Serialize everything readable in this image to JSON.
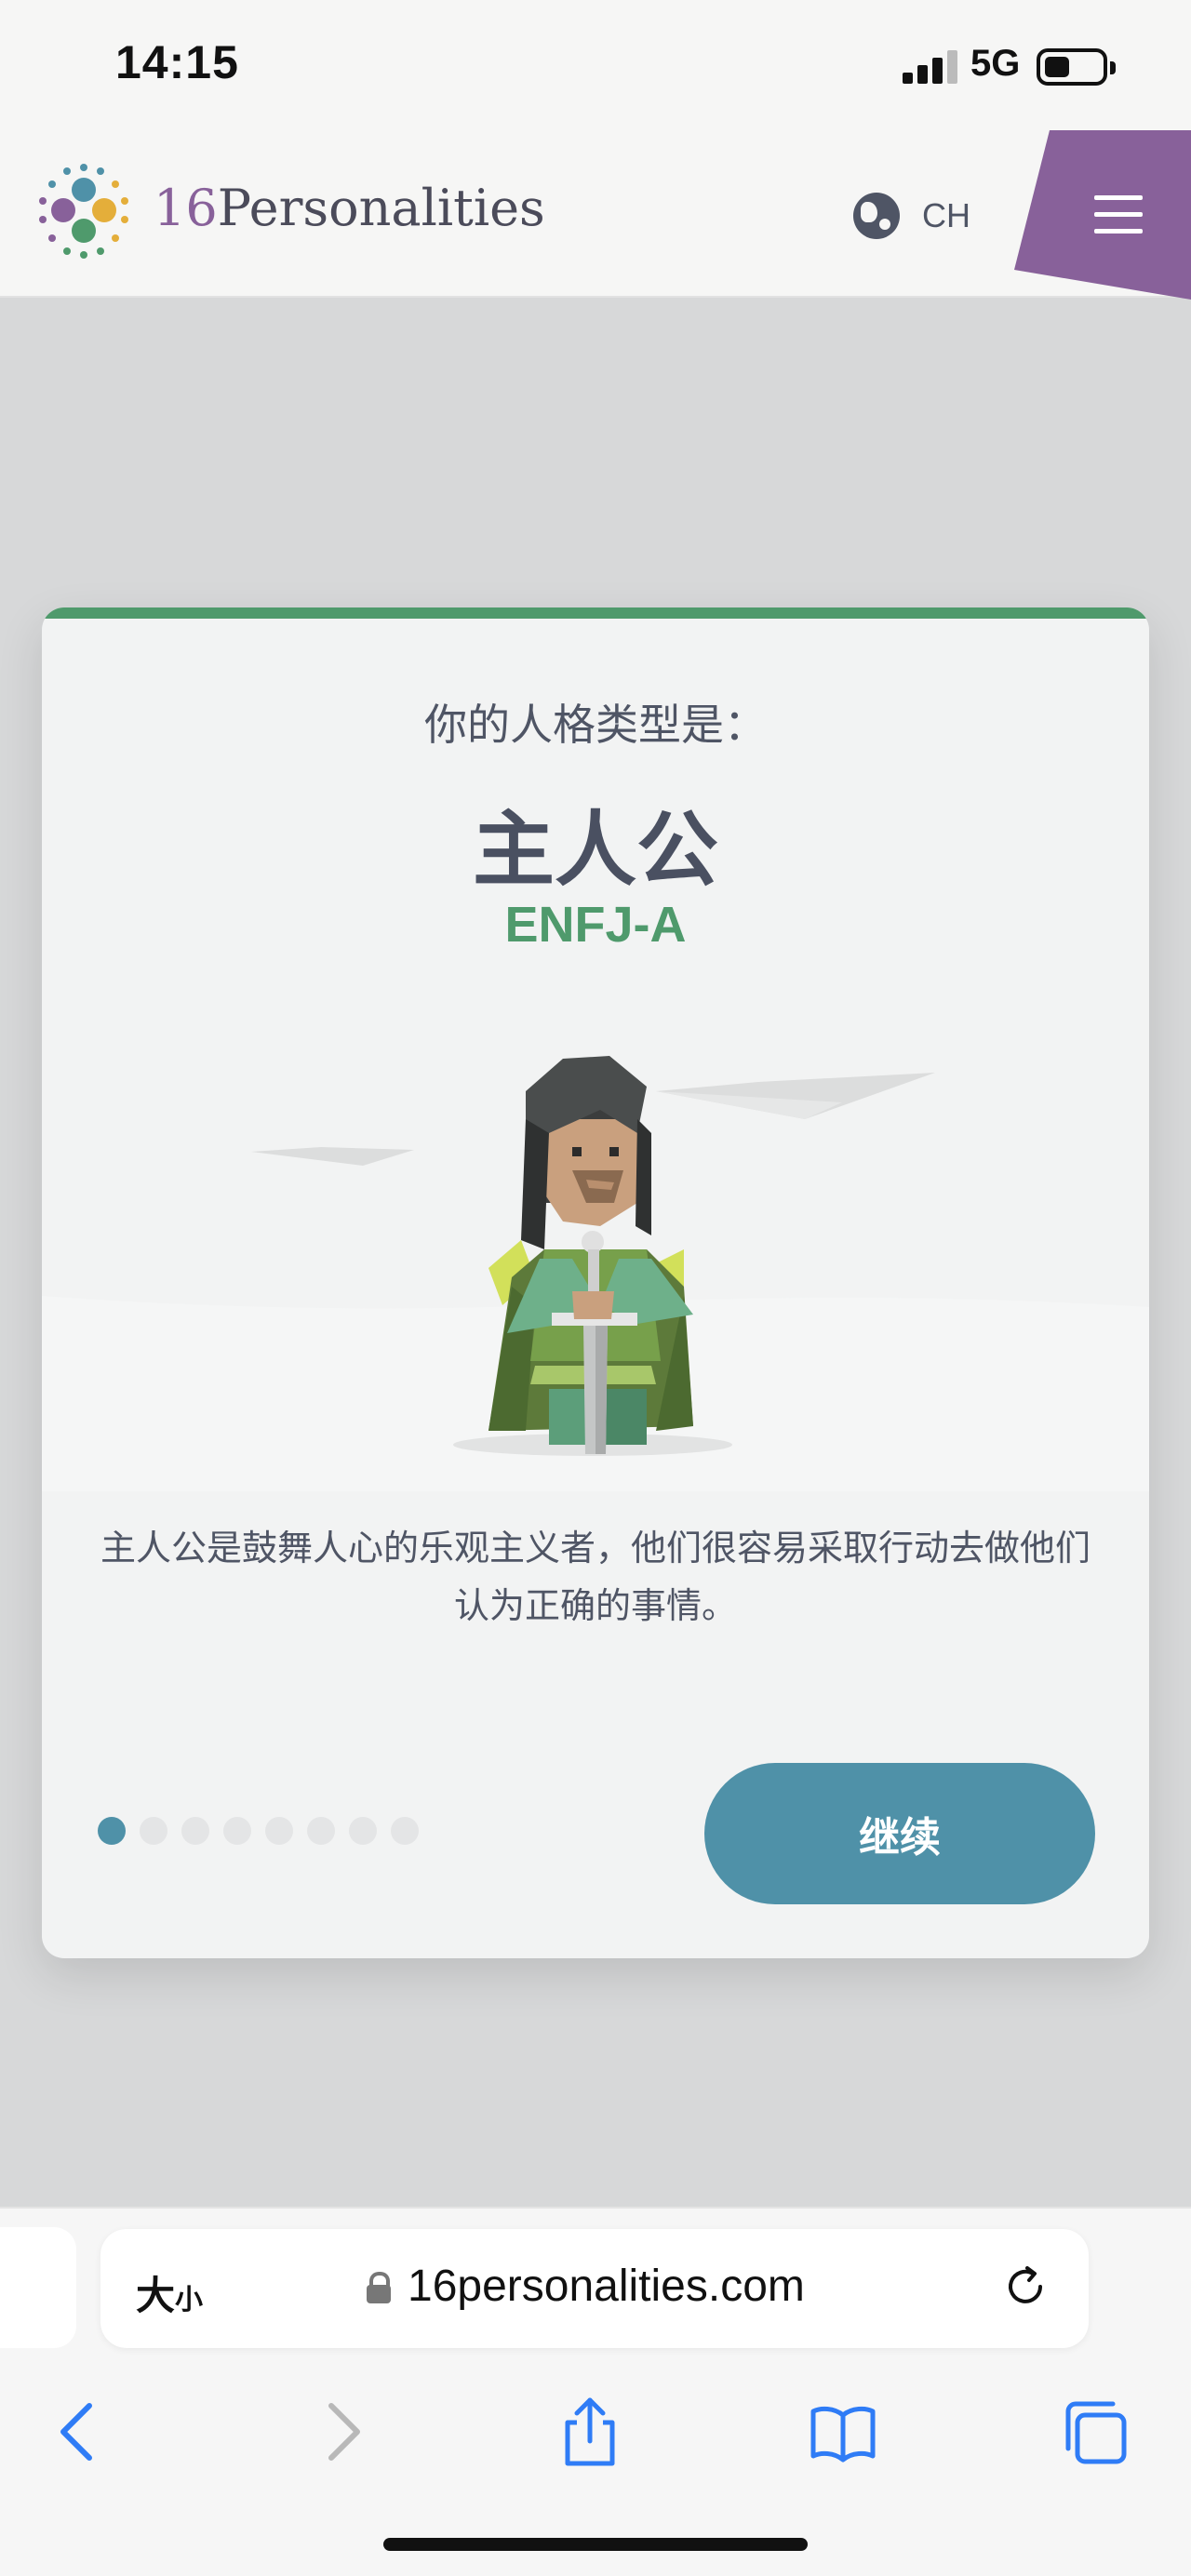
{
  "status_bar": {
    "time": "14:15",
    "network": "5G"
  },
  "header": {
    "logo_number": "16",
    "logo_word": "Personalities",
    "language": "CH",
    "brand_color": "#88619a"
  },
  "card": {
    "heading": "你的人格类型是：",
    "type_name": "主人公",
    "type_code": "ENFJ-A",
    "description": "主人公是鼓舞人心的乐观主义者，他们很容易采取行动去做他们认为正确的事情。",
    "continue_label": "继续",
    "pagination": {
      "total": 8,
      "current": 1
    },
    "accent_color": "#4f9a6c",
    "button_color": "#4f91a8"
  },
  "browser": {
    "text_size_big": "大",
    "text_size_small": "小",
    "url": "16personalities.com"
  }
}
